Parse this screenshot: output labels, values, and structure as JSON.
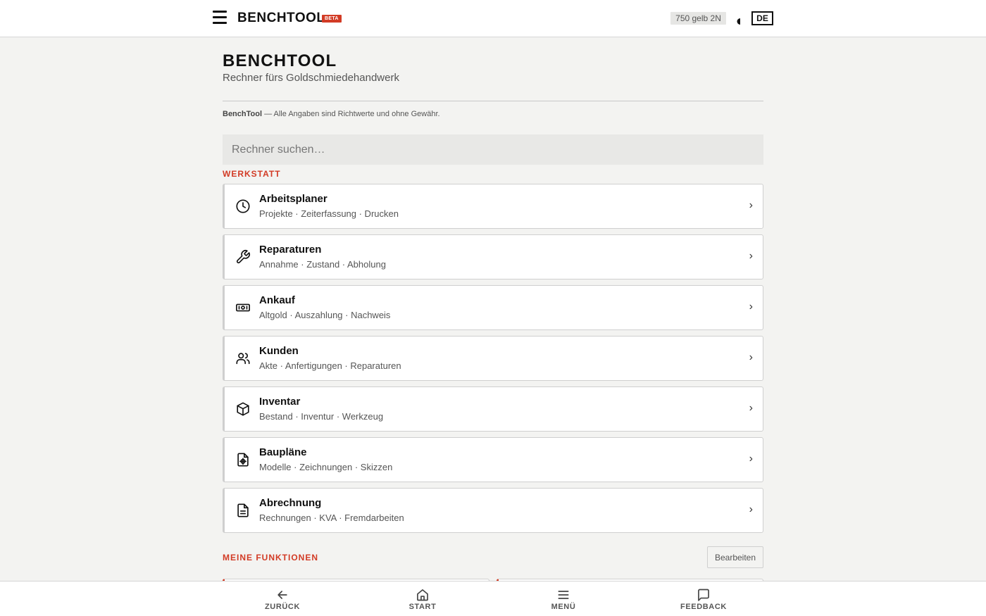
{
  "header": {
    "brand": "BENCHTOOL",
    "badge": "BETA",
    "alloy": "750 gelb 2N",
    "language": "DE"
  },
  "page": {
    "title": "BENCHTOOL",
    "subtitle": "Rechner fürs Goldschmiedehandwerk",
    "disclaimer_brand": "BenchTool",
    "disclaimer_text": " — Alle Angaben sind Richtwerte und ohne Gewähr."
  },
  "search": {
    "placeholder": "Rechner suchen…"
  },
  "workshop": {
    "section_title": "WERKSTATT",
    "items": [
      {
        "icon": "clock-icon",
        "title": "Arbeitsplaner",
        "subtitle": "Projekte · Zeiterfassung · Drucken"
      },
      {
        "icon": "wrench-icon",
        "title": "Reparaturen",
        "subtitle": "Annahme · Zustand · Abholung"
      },
      {
        "icon": "banknote-icon",
        "title": "Ankauf",
        "subtitle": "Altgold · Auszahlung · Nachweis"
      },
      {
        "icon": "users-icon",
        "title": "Kunden",
        "subtitle": "Akte · Anfertigungen · Reparaturen"
      },
      {
        "icon": "box-icon",
        "title": "Inventar",
        "subtitle": "Bestand · Inventur · Werkzeug"
      },
      {
        "icon": "blueprint-icon",
        "title": "Baupläne",
        "subtitle": "Modelle · Zeichnungen · Skizzen"
      },
      {
        "icon": "document-icon",
        "title": "Abrechnung",
        "subtitle": "Rechnungen · KVA · Fremdarbeiten"
      }
    ]
  },
  "favorites": {
    "section_title": "MEINE FUNKTIONEN",
    "edit_label": "Bearbeiten"
  },
  "bottom_nav": {
    "back": "ZURÜCK",
    "start": "START",
    "menu": "MENÜ",
    "feedback": "FEEDBACK"
  },
  "colors": {
    "accent": "#d23b25",
    "background": "#f3f3f1",
    "card_border": "#cfcfcf"
  }
}
